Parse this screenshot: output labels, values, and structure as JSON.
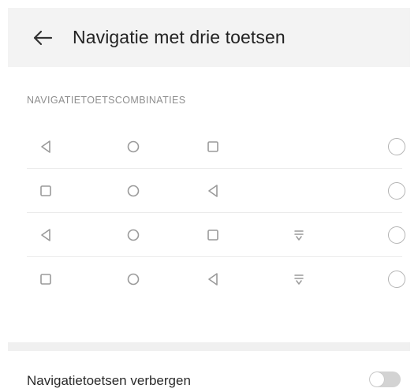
{
  "header": {
    "back_icon": "arrow-left-icon",
    "title": "Navigatie met drie toetsen"
  },
  "section": {
    "label": "NAVIGATIETOETSCOMBINATIES"
  },
  "combinations": [
    {
      "keys": [
        "back",
        "home",
        "recents"
      ],
      "selected": false
    },
    {
      "keys": [
        "recents",
        "home",
        "back"
      ],
      "selected": false
    },
    {
      "keys": [
        "back",
        "home",
        "recents",
        "notifications"
      ],
      "selected": false
    },
    {
      "keys": [
        "recents",
        "home",
        "back",
        "notifications"
      ],
      "selected": false
    }
  ],
  "hide_keys": {
    "label": "Navigatietoetsen verbergen",
    "enabled": false
  },
  "colors": {
    "icon": "#9a9a9a",
    "header_bg": "#f3f3f3",
    "divider": "#ebebeb",
    "toggle_off": "#d3d3d3"
  }
}
